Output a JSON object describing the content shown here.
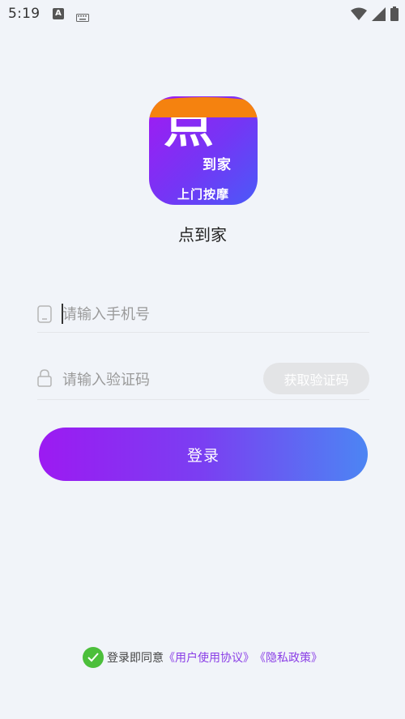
{
  "status_bar": {
    "time": "5:19",
    "icons": [
      "a-notification-icon",
      "keyboard-icon",
      "wifi-icon",
      "signal-icon",
      "battery-icon"
    ]
  },
  "app": {
    "logo_main": "点",
    "logo_sub": "到家",
    "logo_band": "上门按摩",
    "name": "点到家"
  },
  "form": {
    "phone_placeholder": "请输入手机号",
    "code_placeholder": "请输入验证码",
    "get_code_label": "获取验证码",
    "login_label": "登录"
  },
  "agreement": {
    "prefix": "登录即同意",
    "user_agreement": "《用户使用协议》",
    "privacy_policy": "《隐私政策》"
  },
  "colors": {
    "gradient_start": "#9c1af2",
    "gradient_end": "#4c85f3",
    "link": "#8a3ee6",
    "check": "#4cbf3b",
    "logo_band": "#f5820f"
  }
}
